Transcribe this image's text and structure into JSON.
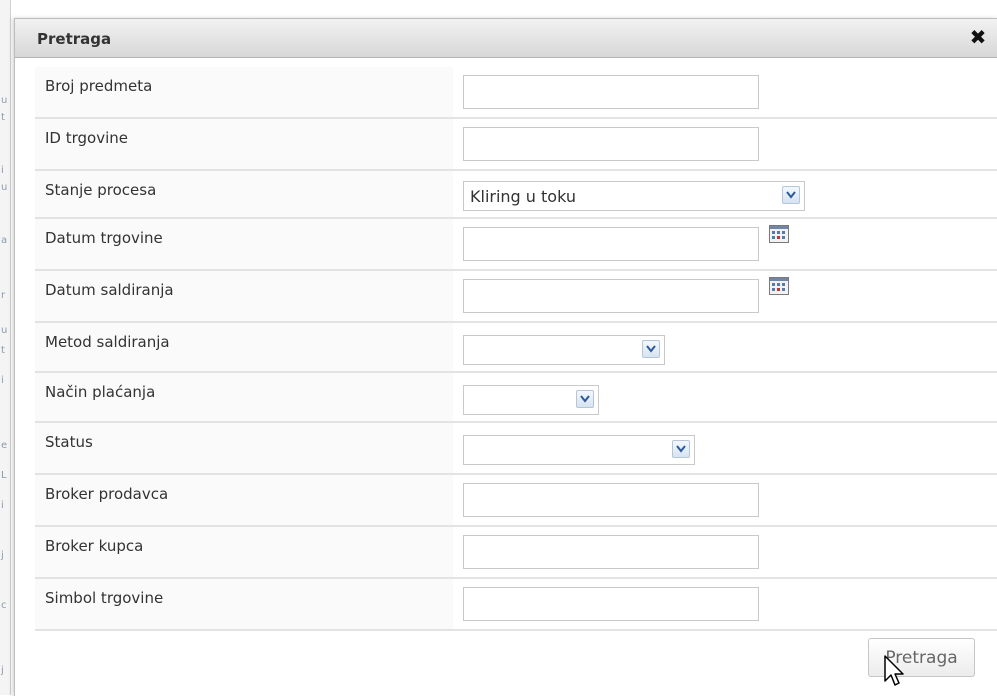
{
  "dialog": {
    "title": "Pretraga",
    "close_symbol": "✖"
  },
  "fields": [
    {
      "label": "Broj predmeta",
      "type": "text",
      "value": ""
    },
    {
      "label": "ID trgovine",
      "type": "text",
      "value": ""
    },
    {
      "label": "Stanje procesa",
      "type": "select",
      "value": "Kliring u toku"
    },
    {
      "label": "Datum trgovine",
      "type": "date",
      "value": "",
      "icon": "calendar-icon"
    },
    {
      "label": "Datum saldiranja",
      "type": "date",
      "value": "",
      "icon": "calendar-icon"
    },
    {
      "label": "Metod saldiranja",
      "type": "select",
      "value": ""
    },
    {
      "label": "Način plaćanja",
      "type": "select",
      "value": ""
    },
    {
      "label": "Status",
      "type": "select",
      "value": ""
    },
    {
      "label": "Broker prodavca",
      "type": "text",
      "value": ""
    },
    {
      "label": "Broker kupca",
      "type": "text",
      "value": ""
    },
    {
      "label": "Simbol trgovine",
      "type": "text",
      "value": ""
    }
  ],
  "search_button": {
    "label": "Pretraga"
  },
  "colors": {
    "titlebar": "#dcdcdc",
    "select_arrow": "#2a5a9a",
    "row_divider": "#e3e3e3"
  }
}
